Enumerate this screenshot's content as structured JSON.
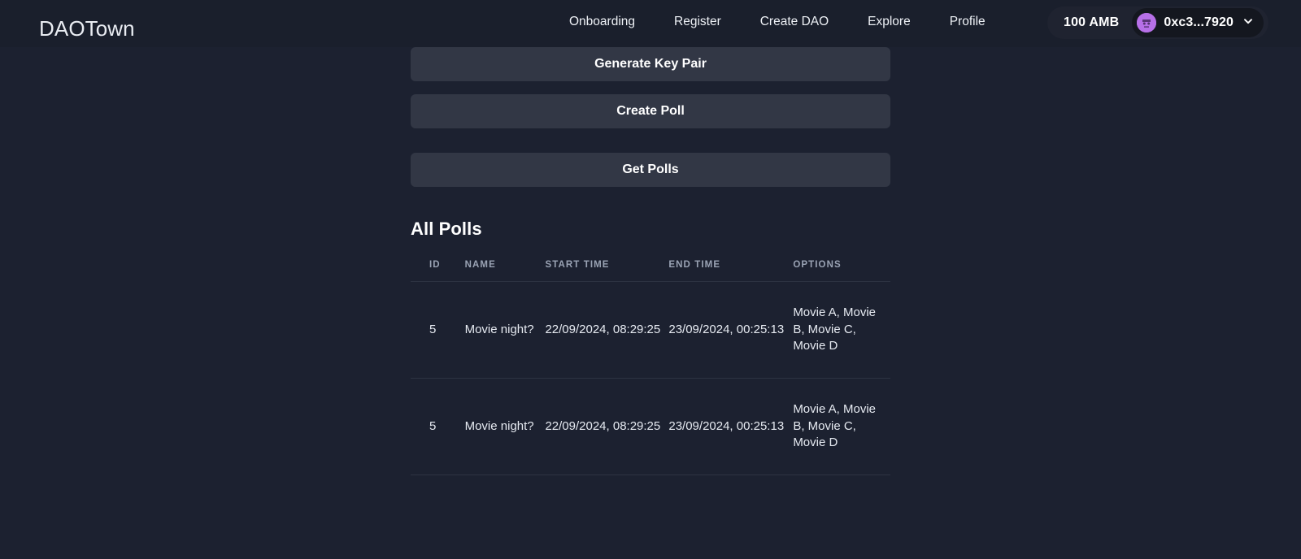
{
  "theme": {
    "page_bg": "#1c2130",
    "header_bg": "#1a1f2c",
    "button_bg": "#323745",
    "accent_purple": "#b770e8",
    "text_primary": "#ffffff",
    "text_muted": "#9aa3b4",
    "divider": "#2d3342"
  },
  "header": {
    "brand": "DAOTown",
    "nav": [
      {
        "label": "Onboarding",
        "name": "nav-onboarding"
      },
      {
        "label": "Register",
        "name": "nav-register"
      },
      {
        "label": "Create DAO",
        "name": "nav-create-dao"
      },
      {
        "label": "Explore",
        "name": "nav-explore"
      },
      {
        "label": "Profile",
        "name": "nav-profile"
      }
    ],
    "wallet": {
      "balance": "100 AMB",
      "address": "0xc3...7920",
      "avatar_icon": "wallet-avatar-blockie",
      "chevron_icon": "chevron-down-icon"
    }
  },
  "main": {
    "buttons": [
      {
        "label": "Generate Key Pair",
        "name": "generate-key-pair-button"
      },
      {
        "label": "Create Poll",
        "name": "create-poll-button"
      },
      {
        "label": "Get Polls",
        "name": "get-polls-button"
      }
    ],
    "section_title": "All Polls",
    "table": {
      "columns": [
        "ID",
        "NAME",
        "START TIME",
        "END TIME",
        "OPTIONS"
      ],
      "rows": [
        {
          "id": "5",
          "name": "Movie night?",
          "start_time": "22/09/2024, 08:29:25",
          "end_time": "23/09/2024, 00:25:13",
          "options": "Movie A, Movie B, Movie C, Movie D"
        },
        {
          "id": "5",
          "name": "Movie night?",
          "start_time": "22/09/2024, 08:29:25",
          "end_time": "23/09/2024, 00:25:13",
          "options": "Movie A, Movie B, Movie C, Movie D"
        }
      ]
    }
  }
}
